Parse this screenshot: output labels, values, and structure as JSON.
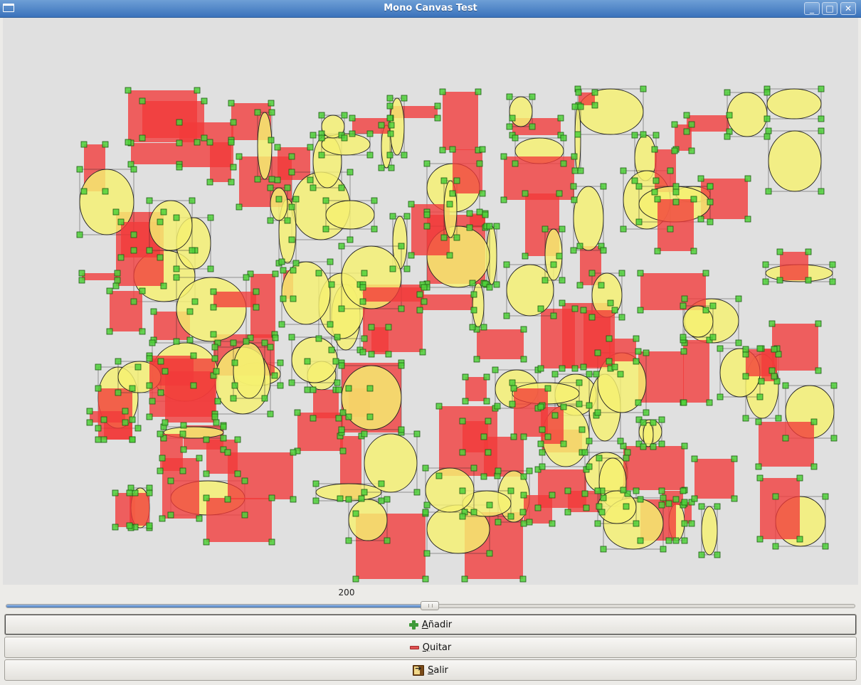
{
  "window": {
    "title": "Mono Canvas Test",
    "minimize_glyph": "_",
    "maximize_glyph": "□",
    "close_glyph": "✕"
  },
  "slider": {
    "value": 200,
    "min": 0,
    "max": 400,
    "value_label": "200"
  },
  "buttons": {
    "add": {
      "mnemonic": "A",
      "rest": "ñadir",
      "icon": "add-icon"
    },
    "remove": {
      "mnemonic": "Q",
      "rest": "uitar",
      "icon": "remove-icon"
    },
    "exit": {
      "mnemonic": "S",
      "rest": "alir",
      "icon": "exit-icon"
    }
  },
  "canvas": {
    "colors": {
      "rect_fill": "#f23a3a",
      "ellipse_fill": "#f5f070",
      "handle_fill": "#4fd03a",
      "outline": "#222222"
    },
    "rects": [
      [
        180,
        127,
        97,
        73
      ],
      [
        200,
        142,
        87,
        52
      ],
      [
        325,
        145,
        56,
        52
      ],
      [
        118,
        203,
        30,
        66
      ],
      [
        184,
        201,
        68,
        30
      ],
      [
        252,
        172,
        76,
        63
      ],
      [
        295,
        200,
        30,
        56
      ],
      [
        336,
        220,
        74,
        71
      ],
      [
        390,
        207,
        46,
        46
      ],
      [
        495,
        166,
        54,
        22
      ],
      [
        548,
        149,
        67,
        17
      ],
      [
        622,
        129,
        50,
        82
      ],
      [
        636,
        210,
        42,
        62
      ],
      [
        720,
        166,
        68,
        24
      ],
      [
        708,
        220,
        99,
        61
      ],
      [
        738,
        272,
        48,
        88
      ],
      [
        813,
        130,
        23,
        18
      ],
      [
        965,
        162,
        60,
        23
      ],
      [
        948,
        175,
        24,
        37
      ],
      [
        920,
        210,
        30,
        60
      ],
      [
        924,
        280,
        51,
        73
      ],
      [
        985,
        251,
        66,
        57
      ],
      [
        1096,
        354,
        40,
        40
      ],
      [
        578,
        287,
        54,
        72
      ],
      [
        600,
        302,
        82,
        97
      ],
      [
        660,
        300,
        22,
        20
      ],
      [
        163,
        298,
        67,
        104
      ],
      [
        170,
        312,
        55,
        50
      ],
      [
        115,
        384,
        50,
        10
      ],
      [
        154,
        409,
        46,
        57
      ],
      [
        216,
        438,
        51,
        40
      ],
      [
        300,
        410,
        60,
        22
      ],
      [
        352,
        385,
        35,
        90
      ],
      [
        398,
        380,
        14,
        40
      ],
      [
        510,
        400,
        84,
        95
      ],
      [
        522,
        460,
        24,
        38
      ],
      [
        510,
        404,
        86,
        20
      ],
      [
        590,
        414,
        76,
        22
      ],
      [
        670,
        463,
        66,
        42
      ],
      [
        760,
        434,
        48,
        84
      ],
      [
        790,
        426,
        68,
        92
      ],
      [
        815,
        346,
        30,
        55
      ],
      [
        820,
        436,
        44,
        80
      ],
      [
        900,
        384,
        92,
        52
      ],
      [
        856,
        476,
        38,
        32
      ],
      [
        897,
        494,
        64,
        72
      ],
      [
        960,
        478,
        37,
        88
      ],
      [
        1085,
        455,
        65,
        66
      ],
      [
        1048,
        491,
        40,
        38
      ],
      [
        210,
        500,
        62,
        42
      ],
      [
        210,
        504,
        92,
        82
      ],
      [
        232,
        522,
        72,
        72
      ],
      [
        138,
        546,
        48,
        72
      ],
      [
        126,
        578,
        50,
        16
      ],
      [
        146,
        590,
        40,
        28
      ],
      [
        258,
        598,
        56,
        34
      ],
      [
        225,
        610,
        32,
        52
      ],
      [
        290,
        618,
        44,
        48
      ],
      [
        228,
        644,
        52,
        85
      ],
      [
        320,
        636,
        92,
        66
      ],
      [
        290,
        700,
        92,
        62
      ],
      [
        162,
        693,
        28,
        48
      ],
      [
        182,
        693,
        28,
        46
      ],
      [
        440,
        548,
        36,
        40
      ],
      [
        418,
        580,
        64,
        54
      ],
      [
        480,
        510,
        84,
        98
      ],
      [
        490,
        546,
        30,
        40
      ],
      [
        478,
        613,
        30,
        88
      ],
      [
        500,
        722,
        98,
        92
      ],
      [
        654,
        530,
        30,
        34
      ],
      [
        617,
        571,
        82,
        98
      ],
      [
        650,
        592,
        36,
        44
      ],
      [
        680,
        614,
        56,
        56
      ],
      [
        722,
        546,
        48,
        68
      ],
      [
        760,
        572,
        32,
        52
      ],
      [
        762,
        604,
        56,
        32
      ],
      [
        756,
        660,
        68,
        54
      ],
      [
        798,
        690,
        48,
        30
      ],
      [
        736,
        696,
        40,
        40
      ],
      [
        653,
        720,
        82,
        94
      ],
      [
        876,
        627,
        86,
        62
      ],
      [
        930,
        690,
        30,
        20
      ],
      [
        962,
        706,
        10,
        30
      ],
      [
        900,
        702,
        50,
        58
      ],
      [
        976,
        645,
        56,
        56
      ],
      [
        1068,
        672,
        56,
        86
      ],
      [
        1066,
        593,
        78,
        63
      ],
      [
        1070,
        490,
        22,
        46
      ],
      [
        300,
        470,
        86,
        58
      ]
    ],
    "ellipses": [
      [
        112,
        238,
        76,
        92
      ],
      [
        210,
        282,
        60,
        70
      ],
      [
        248,
        306,
        48,
        72
      ],
      [
        188,
        352,
        86,
        72
      ],
      [
        248,
        390,
        98,
        90
      ],
      [
        362,
        158,
        20,
        94
      ],
      [
        380,
        264,
        24,
        46
      ],
      [
        392,
        280,
        24,
        90
      ],
      [
        410,
        242,
        82,
        95
      ],
      [
        458,
        282,
        68,
        40
      ],
      [
        452,
        162,
        32,
        32
      ],
      [
        452,
        188,
        68,
        30
      ],
      [
        440,
        190,
        40,
        74
      ],
      [
        536,
        176,
        14,
        60
      ],
      [
        548,
        138,
        20,
        80
      ],
      [
        600,
        230,
        74,
        68
      ],
      [
        624,
        254,
        18,
        80
      ],
      [
        600,
        318,
        88,
        86
      ],
      [
        684,
        318,
        14,
        82
      ],
      [
        552,
        304,
        20,
        74
      ],
      [
        480,
        346,
        84,
        88
      ],
      [
        396,
        368,
        68,
        88
      ],
      [
        448,
        384,
        64,
        92
      ],
      [
        466,
        400,
        40,
        92
      ],
      [
        410,
        474,
        64,
        64
      ],
      [
        432,
        508,
        40,
        40
      ],
      [
        480,
        514,
        84,
        90
      ],
      [
        712,
        372,
        66,
        72
      ],
      [
        766,
        322,
        24,
        72
      ],
      [
        806,
        262,
        42,
        90
      ],
      [
        716,
        136,
        32,
        42
      ],
      [
        724,
        194,
        68,
        36
      ],
      [
        808,
        150,
        8,
        90
      ],
      [
        812,
        125,
        92,
        64
      ],
      [
        832,
        384,
        42,
        62
      ],
      [
        664,
        398,
        16,
        62
      ],
      [
        876,
        240,
        66,
        82
      ],
      [
        892,
        190,
        30,
        64
      ],
      [
        898,
        262,
        100,
        50
      ],
      [
        950,
        262,
        48,
        22
      ],
      [
        1022,
        130,
        56,
        62
      ],
      [
        1078,
        125,
        76,
        42
      ],
      [
        1080,
        184,
        74,
        85
      ],
      [
        1076,
        372,
        94,
        24
      ],
      [
        960,
        430,
        42,
        44
      ],
      [
        962,
        420,
        76,
        62
      ],
      [
        1012,
        490,
        56,
        68
      ],
      [
        1048,
        498,
        46,
        90
      ],
      [
        1104,
        542,
        68,
        74
      ],
      [
        302,
        488,
        78,
        94
      ],
      [
        328,
        482,
        44,
        78
      ],
      [
        330,
        510,
        64,
        32
      ],
      [
        166,
        508,
        60,
        44
      ],
      [
        138,
        516,
        56,
        86
      ],
      [
        214,
        482,
        92,
        82
      ],
      [
        230,
        600,
        84,
        16
      ],
      [
        240,
        676,
        104,
        48
      ],
      [
        184,
        686,
        26,
        56
      ],
      [
        444,
        680,
        92,
        24
      ],
      [
        490,
        702,
        54,
        58
      ],
      [
        512,
        610,
        74,
        82
      ],
      [
        598,
        658,
        68,
        62
      ],
      [
        600,
        710,
        88,
        68
      ],
      [
        650,
        690,
        68,
        36
      ],
      [
        696,
        520,
        60,
        54
      ],
      [
        700,
        662,
        44,
        72
      ],
      [
        720,
        538,
        94,
        30
      ],
      [
        762,
        570,
        66,
        86
      ],
      [
        780,
        526,
        58,
        58
      ],
      [
        840,
        496,
        68,
        84
      ],
      [
        828,
        526,
        44,
        94
      ],
      [
        822,
        636,
        60,
        58
      ],
      [
        842,
        644,
        38,
        68
      ],
      [
        840,
        690,
        54,
        46
      ],
      [
        848,
        700,
        84,
        72
      ],
      [
        898,
        590,
        32,
        34
      ],
      [
        904,
        594,
        14,
        34
      ],
      [
        940,
        708,
        22,
        52
      ],
      [
        986,
        712,
        22,
        68
      ],
      [
        1090,
        698,
        70,
        70
      ]
    ]
  }
}
